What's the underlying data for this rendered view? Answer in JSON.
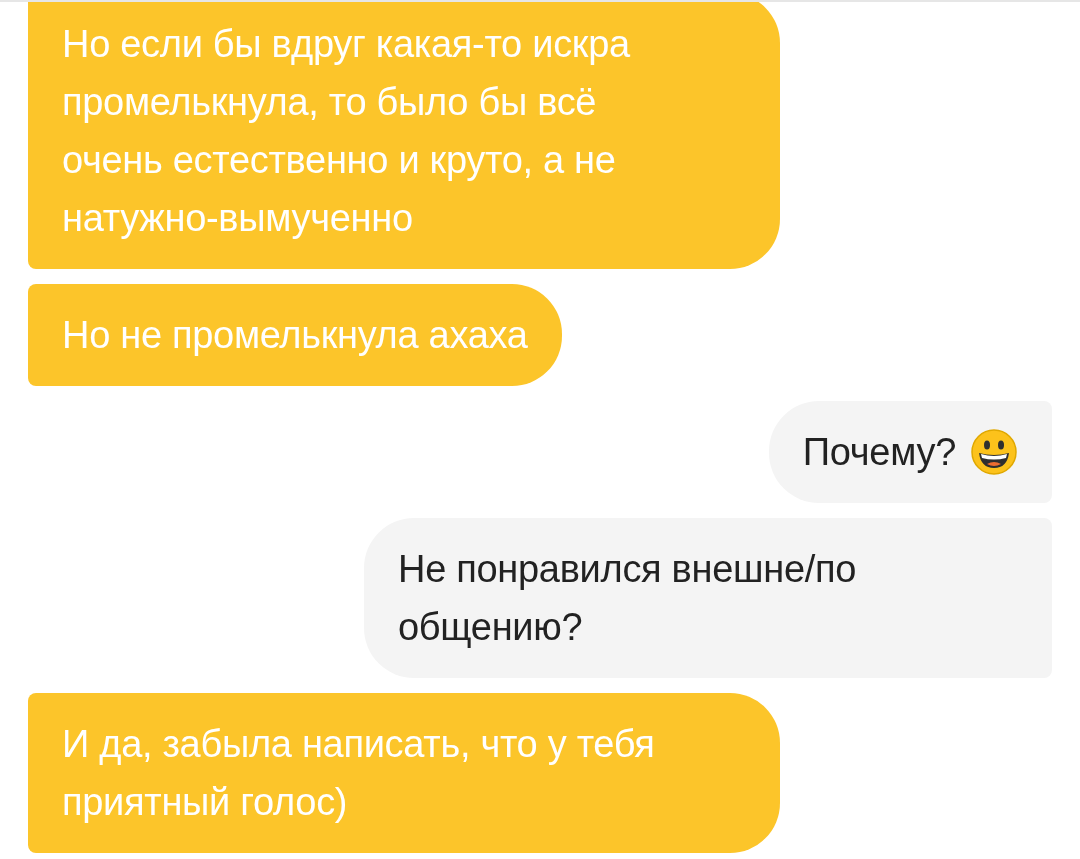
{
  "messages": [
    {
      "kind": "incoming",
      "text": "Но если бы вдруг какая-то искра промелькнула, то было бы всё очень естественно и круто, а не натужно-вымученно"
    },
    {
      "kind": "incoming",
      "text": "Но не промелькнула ахаха"
    },
    {
      "kind": "outgoing_with_smiley",
      "text": "Почему?"
    },
    {
      "kind": "outgoing",
      "text": "Не понравился внешне/по общению?"
    },
    {
      "kind": "incoming",
      "text": "И да, забыла написать, что у тебя приятный голос)"
    }
  ]
}
